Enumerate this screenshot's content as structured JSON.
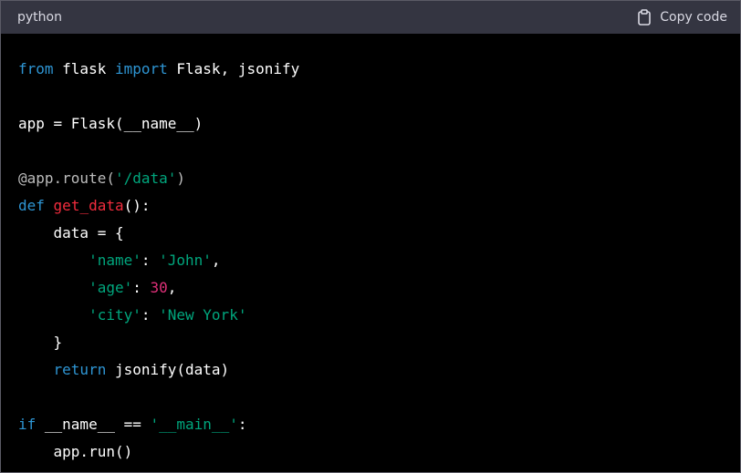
{
  "header": {
    "language": "python",
    "copy_label": "Copy code",
    "copy_icon": "clipboard-icon"
  },
  "colors": {
    "keyword": "#2e95d3",
    "string": "#00a67d",
    "function": "#f22c3d",
    "number": "#df3079",
    "decorator": "#bcbcbc",
    "text": "#ffffff",
    "header_bg": "#343541",
    "code_bg": "#000000"
  },
  "code": {
    "lines": [
      [
        {
          "t": "from",
          "c": "kw"
        },
        {
          "t": " flask ",
          "c": "plain"
        },
        {
          "t": "import",
          "c": "kw"
        },
        {
          "t": " Flask, jsonify",
          "c": "plain"
        }
      ],
      [],
      [
        {
          "t": "app = Flask(__name__)",
          "c": "plain"
        }
      ],
      [],
      [
        {
          "t": "@app.route(",
          "c": "dec"
        },
        {
          "t": "'/data'",
          "c": "str"
        },
        {
          "t": ")",
          "c": "dec"
        }
      ],
      [
        {
          "t": "def",
          "c": "kw"
        },
        {
          "t": " ",
          "c": "plain"
        },
        {
          "t": "get_data",
          "c": "fn"
        },
        {
          "t": "():",
          "c": "plain"
        }
      ],
      [
        {
          "t": "    data = {",
          "c": "plain"
        }
      ],
      [
        {
          "t": "        ",
          "c": "plain"
        },
        {
          "t": "'name'",
          "c": "str"
        },
        {
          "t": ": ",
          "c": "plain"
        },
        {
          "t": "'John'",
          "c": "str"
        },
        {
          "t": ",",
          "c": "plain"
        }
      ],
      [
        {
          "t": "        ",
          "c": "plain"
        },
        {
          "t": "'age'",
          "c": "str"
        },
        {
          "t": ": ",
          "c": "plain"
        },
        {
          "t": "30",
          "c": "num"
        },
        {
          "t": ",",
          "c": "plain"
        }
      ],
      [
        {
          "t": "        ",
          "c": "plain"
        },
        {
          "t": "'city'",
          "c": "str"
        },
        {
          "t": ": ",
          "c": "plain"
        },
        {
          "t": "'New York'",
          "c": "str"
        }
      ],
      [
        {
          "t": "    }",
          "c": "plain"
        }
      ],
      [
        {
          "t": "    ",
          "c": "plain"
        },
        {
          "t": "return",
          "c": "kw"
        },
        {
          "t": " jsonify(data)",
          "c": "plain"
        }
      ],
      [],
      [
        {
          "t": "if",
          "c": "kw"
        },
        {
          "t": " __name__ == ",
          "c": "plain"
        },
        {
          "t": "'__main__'",
          "c": "str"
        },
        {
          "t": ":",
          "c": "plain"
        }
      ],
      [
        {
          "t": "    app.run()",
          "c": "plain"
        }
      ]
    ]
  }
}
